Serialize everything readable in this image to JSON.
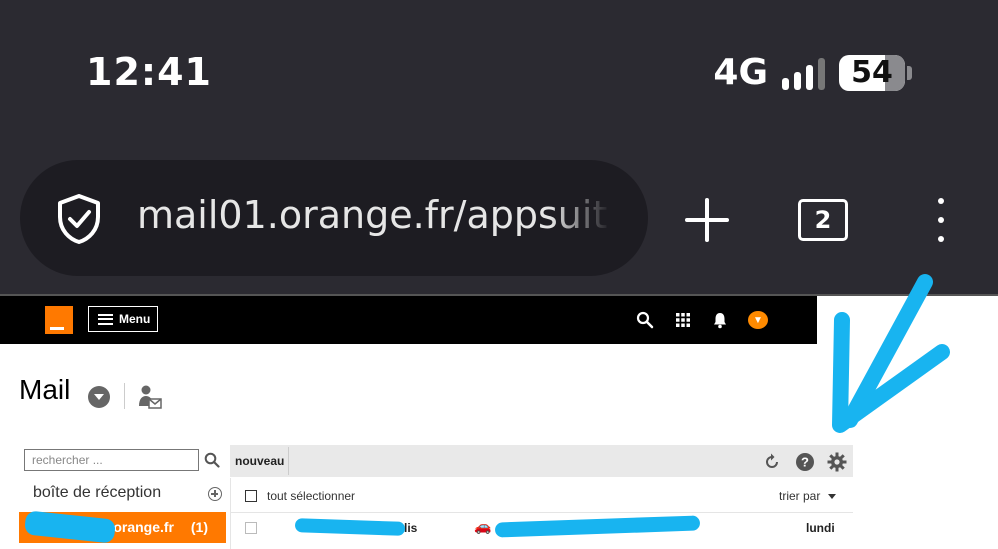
{
  "status_bar": {
    "time": "12:41",
    "network": "4G",
    "battery": "54",
    "battery_level_percent": 54
  },
  "browser": {
    "url": "mail01.orange.fr/appsuit",
    "tab_count": "2",
    "icons": [
      "shield-check-icon",
      "plus-icon",
      "tabs-icon",
      "kebab-menu-icon"
    ]
  },
  "app_header": {
    "menu_label": "Menu",
    "icons": [
      "search-icon",
      "apps-grid-icon",
      "bell-icon",
      "avatar-pumpkin-icon"
    ]
  },
  "page": {
    "title": "Mail"
  },
  "sidebar": {
    "search_placeholder": "rechercher ...",
    "folder_label": "boîte de réception",
    "account_label": "orange.fr",
    "account_count": "(1)"
  },
  "toolbar": {
    "new_label": "nouveau",
    "icons": [
      "refresh-icon",
      "help-icon",
      "settings-gear-icon"
    ]
  },
  "list": {
    "select_all_label": "tout sélectionner",
    "sort_label": "trier par",
    "rows": [
      {
        "sender_visible": "lis",
        "date": "lundi",
        "icon": "car-emoji"
      }
    ]
  },
  "colors": {
    "brand_orange": "#ff7900",
    "annotation_blue": "#18b4f0",
    "browser_bg": "#2b2a31"
  }
}
